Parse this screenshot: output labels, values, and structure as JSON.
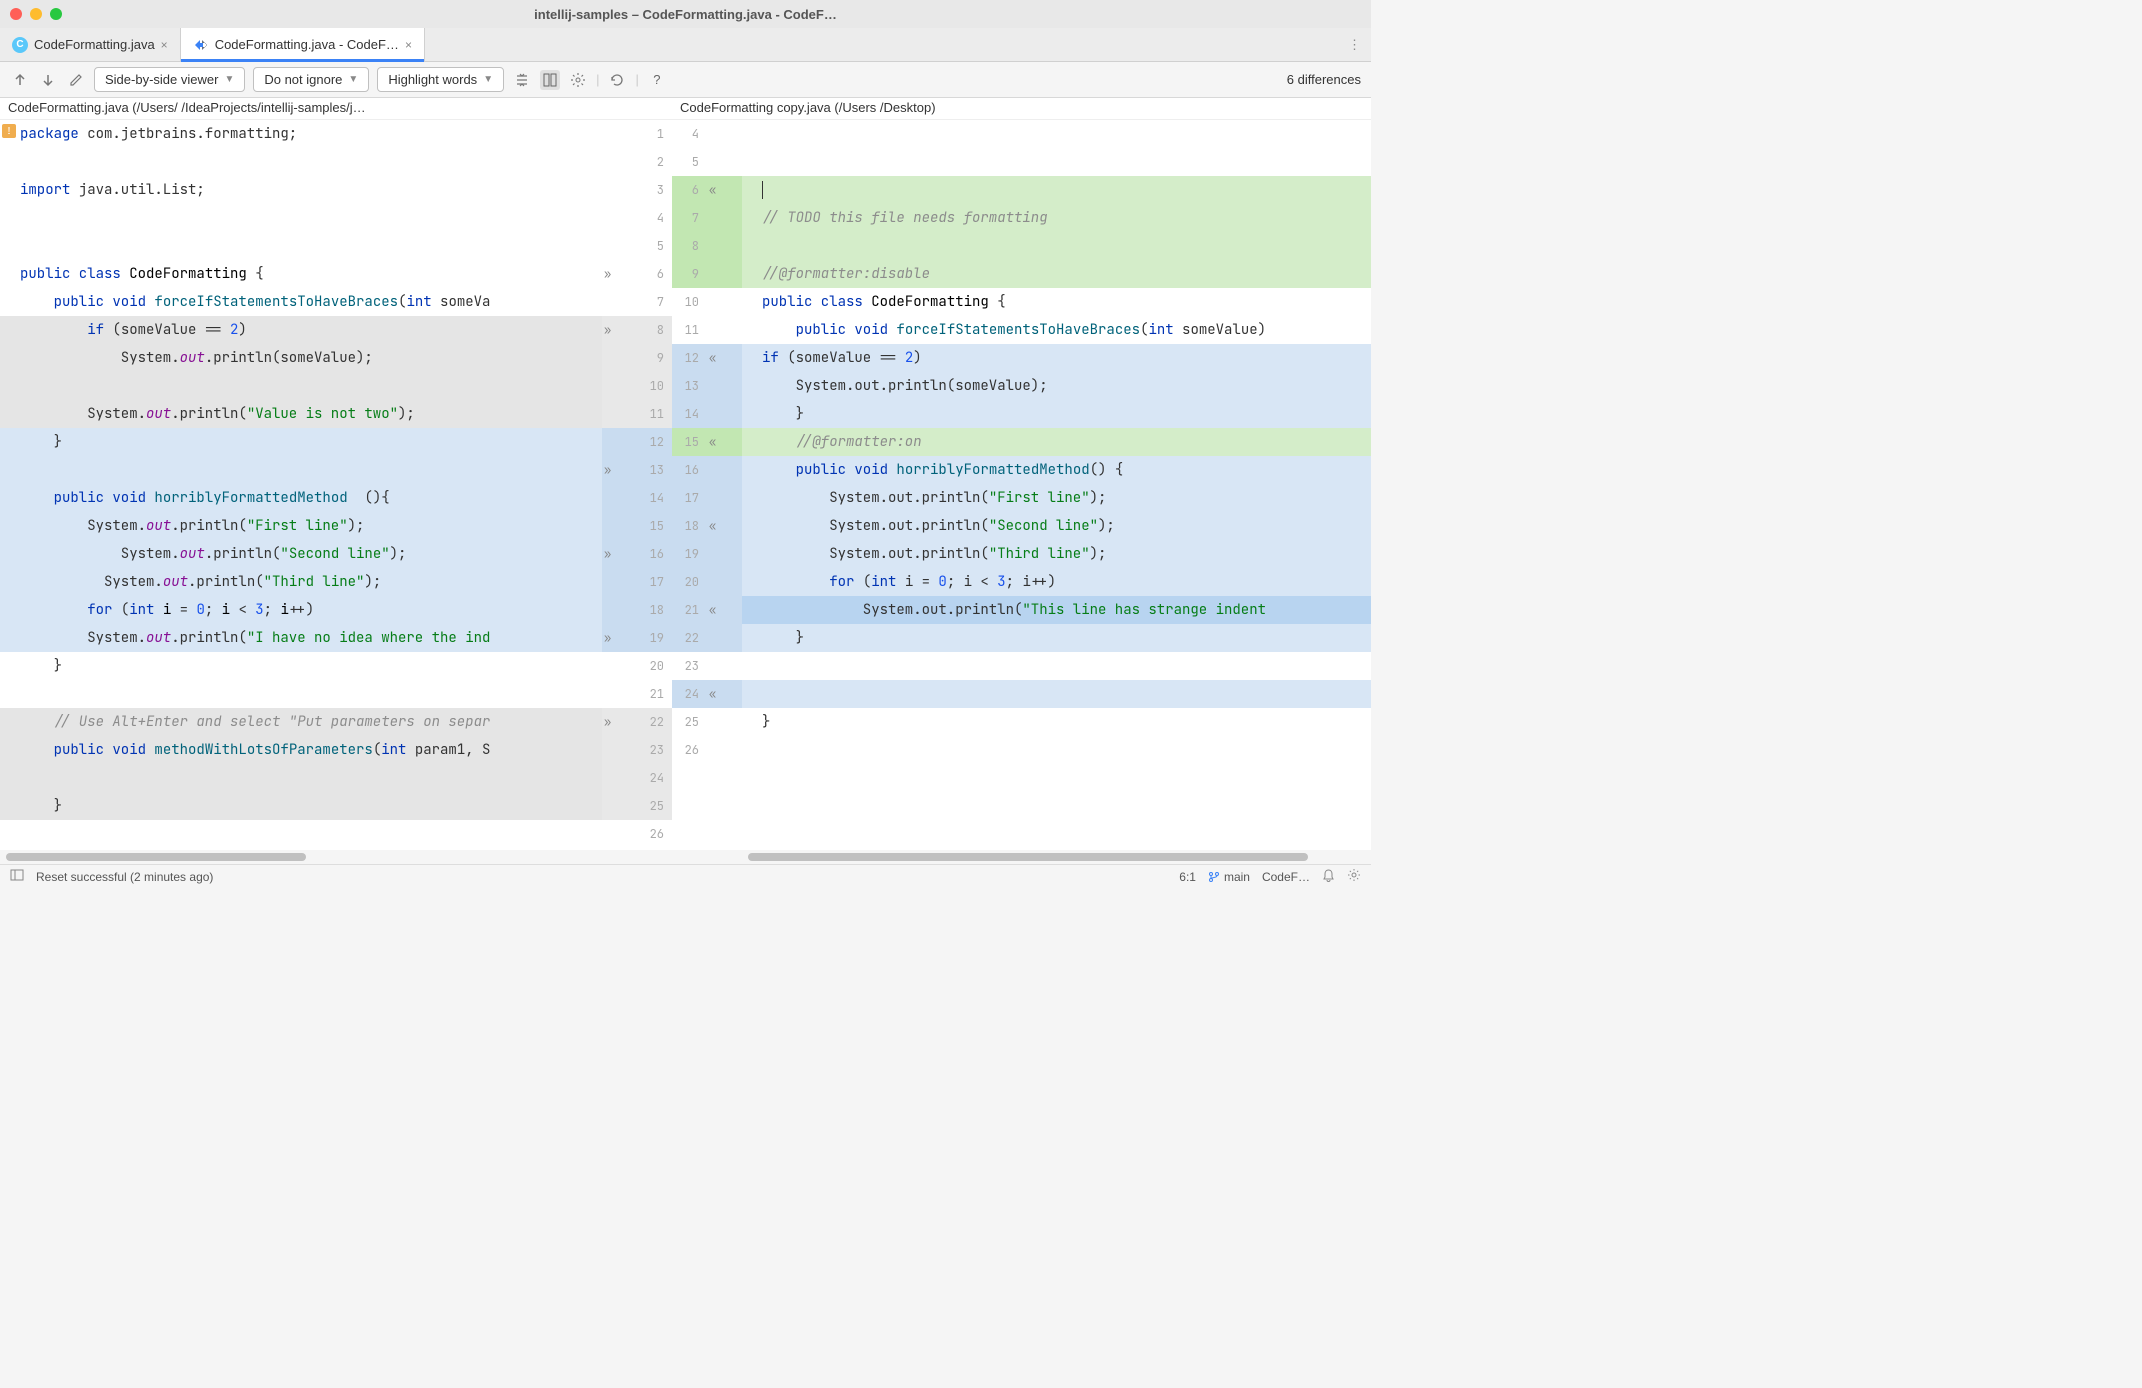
{
  "window": {
    "title": "intellij-samples – CodeFormatting.java - CodeF…"
  },
  "tabs": [
    {
      "icon": "C",
      "label": "CodeFormatting.java",
      "active": false
    },
    {
      "icon": "diff",
      "label": "CodeFormatting.java - CodeF…",
      "active": true
    }
  ],
  "toolbar": {
    "viewer_mode": "Side-by-side viewer",
    "ignore_mode": "Do not ignore",
    "highlight_mode": "Highlight words",
    "diff_count": "6 differences"
  },
  "paths": {
    "left": "CodeFormatting.java (/Users/                           /IdeaProjects/intellij-samples/j…",
    "right": "CodeFormatting copy.java (/Users /Desktop)"
  },
  "left_code": [
    {
      "n": 1,
      "hl": "none",
      "warn": true,
      "html": "<span class='kw'>package</span> com.jetbrains.formatting;"
    },
    {
      "n": 2,
      "hl": "none",
      "html": ""
    },
    {
      "n": 3,
      "hl": "none",
      "html": "<span class='kw'>import</span> java.util.List;"
    },
    {
      "n": 4,
      "hl": "none",
      "html": ""
    },
    {
      "n": 5,
      "hl": "none",
      "html": ""
    },
    {
      "n": 6,
      "hl": "none",
      "mark": "»",
      "html": "<span class='kw'>public class</span> <span class='ident'>CodeFormatting</span> {"
    },
    {
      "n": 7,
      "hl": "none",
      "html": "    <span class='kw'>public void</span> <span class='method'>forceIfStatementsToHaveBraces</span>(<span class='kw'>int</span> someVa"
    },
    {
      "n": 8,
      "hl": "gray",
      "mark": "»",
      "html": "        <span class='kw'>if</span> (someValue == <span class='num'>2</span>)"
    },
    {
      "n": 9,
      "hl": "gray",
      "html": "            System.<span class='field'>out</span>.println(someValue);"
    },
    {
      "n": 10,
      "hl": "gray",
      "html": ""
    },
    {
      "n": 11,
      "hl": "gray",
      "html": "        System.<span class='field'>out</span>.println(<span class='str'>\"Value is not two\"</span>);"
    },
    {
      "n": 12,
      "hl": "blue",
      "html": "    }"
    },
    {
      "n": 13,
      "hl": "blue",
      "mark": "»",
      "html": ""
    },
    {
      "n": 14,
      "hl": "blue",
      "html": "    <span class='kw'>public void</span> <span class='method'>horriblyFormattedMethod</span>  (){"
    },
    {
      "n": 15,
      "hl": "blue",
      "html": "        System.<span class='field'>out</span>.println(<span class='str'>\"First line\"</span>);"
    },
    {
      "n": 16,
      "hl": "blue",
      "mark": "»",
      "html": "            System.<span class='field'>out</span>.println(<span class='str'>\"Second line\"</span>);"
    },
    {
      "n": 17,
      "hl": "blue",
      "html": "          System.<span class='field'>out</span>.println(<span class='str'>\"Third line\"</span>);"
    },
    {
      "n": 18,
      "hl": "blue",
      "html": "        <span class='kw'>for</span> (<span class='kw'>int</span> <span class='ident'>i</span> = <span class='num'>0</span>; <span class='ident'>i</span> &lt; <span class='num'>3</span>; <span class='ident'>i</span>++)"
    },
    {
      "n": 19,
      "hl": "blue",
      "mark": "»",
      "html": "        System.<span class='field'>out</span>.println(<span class='str'>\"I have no idea where the ind</span>"
    },
    {
      "n": 20,
      "hl": "none",
      "html": "    }"
    },
    {
      "n": 21,
      "hl": "none",
      "html": ""
    },
    {
      "n": 22,
      "hl": "gray",
      "mark": "»",
      "html": "    <span class='cmt'>// Use Alt+Enter and select \"Put parameters on separ</span>"
    },
    {
      "n": 23,
      "hl": "gray",
      "html": "    <span class='kw'>public void</span> <span class='method'>methodWithLotsOfParameters</span>(<span class='kw'>int</span> param1, S"
    },
    {
      "n": 24,
      "hl": "gray",
      "html": ""
    },
    {
      "n": 25,
      "hl": "gray",
      "html": "    }"
    },
    {
      "n": 26,
      "hl": "none",
      "html": ""
    }
  ],
  "right_code": [
    {
      "n": 4,
      "hl": "none",
      "html": ""
    },
    {
      "n": 5,
      "hl": "none",
      "html": ""
    },
    {
      "n": 6,
      "hl": "green",
      "rev": "«",
      "html": "<span style='border-left:1px solid #333;'></span>"
    },
    {
      "n": 7,
      "hl": "green",
      "html": "<span class='cmt'>// TODO this file needs formatting</span>"
    },
    {
      "n": 8,
      "hl": "green",
      "html": ""
    },
    {
      "n": 9,
      "hl": "green",
      "html": "<span class='cmt'>//@formatter:disable</span>"
    },
    {
      "n": 10,
      "hl": "none",
      "html": "<span class='kw'>public class</span> <span class='ident'>CodeFormatting</span> {"
    },
    {
      "n": 11,
      "hl": "none",
      "html": "    <span class='kw'>public void</span> <span class='method'>forceIfStatementsToHaveBraces</span>(<span class='kw'>int</span> someValue)"
    },
    {
      "n": 12,
      "hl": "blue",
      "rev": "«",
      "html": "<span class='kw'>if</span> (someValue == <span class='num'>2</span>)"
    },
    {
      "n": 13,
      "hl": "blue",
      "html": "    System.out.println(someValue);"
    },
    {
      "n": 14,
      "hl": "blue",
      "html": "    }"
    },
    {
      "n": 15,
      "hl": "green",
      "rev": "«",
      "html": "    <span class='cmt'>//@formatter:on</span>"
    },
    {
      "n": 16,
      "hl": "blue",
      "html": "    <span class='kw'>public void</span> <span class='method'>horriblyFormattedMethod</span>() {"
    },
    {
      "n": 17,
      "hl": "blue",
      "html": "        System.out.println(<span class='str'>\"First line\"</span>);"
    },
    {
      "n": 18,
      "hl": "blue",
      "rev": "«",
      "html": "        System.out.println(<span class='str'>\"Second line\"</span>);"
    },
    {
      "n": 19,
      "hl": "blue",
      "html": "        System.out.println(<span class='str'>\"Third line\"</span>);"
    },
    {
      "n": 20,
      "hl": "blue",
      "html": "        <span class='kw'>for</span> (<span class='kw'>int</span> i = <span class='num'>0</span>; i &lt; <span class='num'>3</span>; i++)"
    },
    {
      "n": 21,
      "hl": "blue-strong",
      "rev": "«",
      "html": "            System.out.println(<span class='str'>\"This line has strange indent</span>"
    },
    {
      "n": 22,
      "hl": "blue",
      "html": "    }"
    },
    {
      "n": 23,
      "hl": "none",
      "html": ""
    },
    {
      "n": 24,
      "hl": "blue",
      "rev": "«",
      "html": ""
    },
    {
      "n": 25,
      "hl": "none",
      "html": "}"
    },
    {
      "n": 26,
      "hl": "none",
      "html": ""
    }
  ],
  "status": {
    "message": "Reset successful (2 minutes ago)",
    "cursor": "6:1",
    "branch": "main",
    "branch_label": "CodeF…"
  }
}
